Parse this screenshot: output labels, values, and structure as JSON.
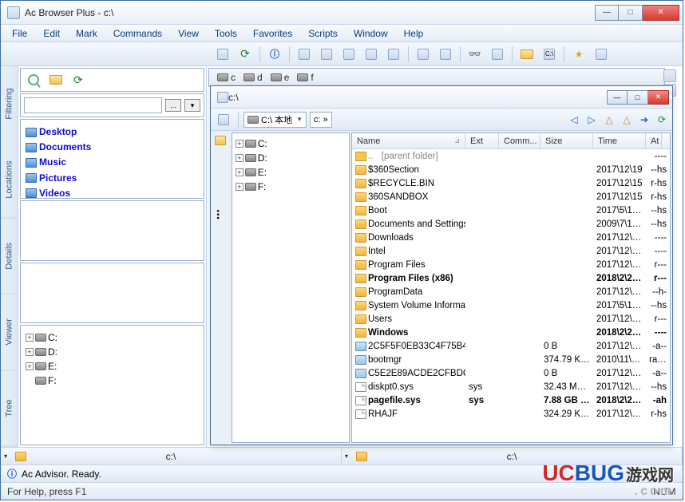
{
  "title": "Ac Browser Plus - c:\\",
  "menubar": [
    "File",
    "Edit",
    "Mark",
    "Commands",
    "View",
    "Tools",
    "Favorites",
    "Scripts",
    "Window",
    "Help"
  ],
  "drives_top": [
    "c",
    "d",
    "e",
    "f"
  ],
  "vtabs": [
    "Filtering",
    "Locations",
    "Details",
    "Viewer",
    "Tree"
  ],
  "locations": [
    "Desktop",
    "Documents",
    "Music",
    "Pictures",
    "Videos"
  ],
  "left_drives": [
    "C:",
    "D:",
    "E:",
    "F:"
  ],
  "subwin": {
    "title": "c:\\",
    "combo1": "C:\\ 本地",
    "crumb": "c: »",
    "tree": [
      "C:",
      "D:",
      "E:",
      "F:"
    ]
  },
  "columns": {
    "name": "Name",
    "ext": "Ext",
    "comm": "Comm...",
    "size": "Size",
    "time": "Time",
    "att": "At"
  },
  "parent_label": "[parent folder]",
  "files": [
    {
      "t": "folder",
      "name": "$360Section",
      "ext": "",
      "size": "",
      "time": "2017\\12\\19",
      "att": "--hs",
      "bold": false
    },
    {
      "t": "folder",
      "name": "$RECYCLE.BIN",
      "ext": "",
      "size": "",
      "time": "2017\\12\\15",
      "att": "r-hs",
      "bold": false
    },
    {
      "t": "folder",
      "name": "360SANDBOX",
      "ext": "",
      "size": "",
      "time": "2017\\12\\15",
      "att": "r-hs",
      "bold": false
    },
    {
      "t": "folder",
      "name": "Boot",
      "ext": "",
      "size": "",
      "time": "2017\\5\\19 ...",
      "att": "--hs",
      "bold": false
    },
    {
      "t": "folder",
      "name": "Documents and Settings",
      "ext": "",
      "size": "",
      "time": "2009\\7\\14 ...",
      "att": "--hs",
      "bold": false
    },
    {
      "t": "folder",
      "name": "Downloads",
      "ext": "",
      "size": "",
      "time": "2017\\12\\15 ...",
      "att": "----",
      "bold": false
    },
    {
      "t": "folder",
      "name": "Intel",
      "ext": "",
      "size": "",
      "time": "2017\\12\\16 ...",
      "att": "----",
      "bold": false
    },
    {
      "t": "folder",
      "name": "Program Files",
      "ext": "",
      "size": "",
      "time": "2017\\12\\20 ...",
      "att": "r---",
      "bold": false
    },
    {
      "t": "folder",
      "name": "Program Files (x86)",
      "ext": "",
      "size": "",
      "time": "2018\\2\\25 ...",
      "att": "r---",
      "bold": true
    },
    {
      "t": "folder",
      "name": "ProgramData",
      "ext": "",
      "size": "",
      "time": "2017\\12\\19 ...",
      "att": "--h-",
      "bold": false
    },
    {
      "t": "folder",
      "name": "System Volume Informa...",
      "ext": "",
      "size": "",
      "time": "2017\\5\\19 ...",
      "att": "--hs",
      "bold": false
    },
    {
      "t": "folder",
      "name": "Users",
      "ext": "",
      "size": "",
      "time": "2017\\12\\15 ...",
      "att": "r---",
      "bold": false
    },
    {
      "t": "folder",
      "name": "Windows",
      "ext": "",
      "size": "",
      "time": "2018\\2\\25 ...",
      "att": "----",
      "bold": true
    },
    {
      "t": "sys",
      "name": "2C5F5F0EB33C4F75B4...",
      "ext": "",
      "size": "0 B",
      "time": "2017\\12\\15 ...",
      "att": "-a--",
      "bold": false
    },
    {
      "t": "sys",
      "name": "bootmgr",
      "ext": "",
      "size": "374.79 KB ( ...",
      "time": "2010\\11\\21 ...",
      "att": "rahs",
      "bold": false
    },
    {
      "t": "sys",
      "name": "C5E2E89ACDE2CFBDC...",
      "ext": "",
      "size": "0 B",
      "time": "2017\\12\\15 ...",
      "att": "-a--",
      "bold": false
    },
    {
      "t": "file",
      "name": "diskpt0.sys",
      "ext": "sys",
      "size": "32.43 MB  (3...",
      "time": "2017\\12\\20 ...",
      "att": "--hs",
      "bold": false
    },
    {
      "t": "file",
      "name": "pagefile.sys",
      "ext": "sys",
      "size": "7.88 GB (8 4...",
      "time": "2018\\2\\25 ...",
      "att": "-ah",
      "bold": true
    },
    {
      "t": "file",
      "name": "RHAJF",
      "ext": "",
      "size": "324.29 KB ( ...",
      "time": "2017\\12\\15 ...",
      "att": "r-hs",
      "bold": false
    }
  ],
  "pathbar": {
    "left": "c:\\",
    "right": "c:\\"
  },
  "advisor": "Ac Advisor. Ready.",
  "statusbar": {
    "left": "For Help, press F1",
    "right": "NUM"
  },
  "watermark": {
    "a": "UC",
    "b": "BUG",
    "cn": "游戏网",
    "sub": ".com"
  },
  "parent_dash": "----",
  "ellipsis": "..."
}
